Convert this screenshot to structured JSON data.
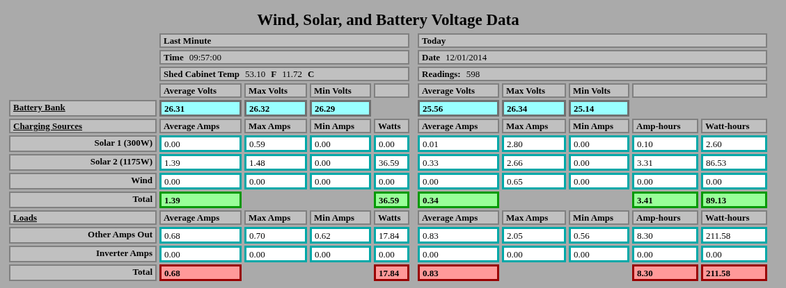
{
  "title": "Wind, Solar, and Battery Voltage Data",
  "info_rows": [
    {
      "left": [
        {
          "text": "Last Minute",
          "bold": true
        }
      ],
      "right": [
        {
          "text": "Today",
          "bold": true
        }
      ]
    },
    {
      "left": [
        {
          "text": "Time",
          "bold": true
        },
        {
          "text": "09:57:00",
          "bold": false
        }
      ],
      "right": [
        {
          "text": "Date",
          "bold": true
        },
        {
          "text": "12/01/2014",
          "bold": false
        }
      ]
    },
    {
      "left": [
        {
          "text": "Shed Cabinet Temp",
          "bold": true
        },
        {
          "text": "53.10",
          "bold": false
        },
        {
          "text": "F",
          "bold": true
        },
        {
          "text": "11.72",
          "bold": false
        },
        {
          "text": "C",
          "bold": true
        }
      ],
      "right": [
        {
          "text": "Readings:",
          "bold": true
        },
        {
          "text": "598",
          "bold": false
        }
      ]
    }
  ],
  "rows": [
    {
      "cells": [
        {
          "kind": "header",
          "text": "Average Volts"
        },
        {
          "kind": "header",
          "text": "Max Volts"
        },
        {
          "kind": "header",
          "text": "Min Volts"
        },
        {
          "kind": "empty"
        },
        {
          "kind": "header",
          "text": "Average Volts"
        },
        {
          "kind": "header",
          "text": "Max Volts"
        },
        {
          "kind": "header",
          "text": "Min Volts"
        },
        {
          "kind": "empty-wide"
        }
      ]
    },
    {
      "label": {
        "kind": "section",
        "text": "Battery Bank"
      },
      "cells": [
        {
          "kind": "volts",
          "text": "26.31"
        },
        {
          "kind": "volts",
          "text": "26.32"
        },
        {
          "kind": "volts",
          "text": "26.29"
        },
        {
          "kind": "blank"
        },
        {
          "kind": "volts",
          "text": "25.56"
        },
        {
          "kind": "volts",
          "text": "26.34"
        },
        {
          "kind": "volts",
          "text": "25.14"
        },
        {
          "kind": "blank"
        },
        {
          "kind": "blank"
        }
      ]
    },
    {
      "label": {
        "kind": "section",
        "text": "Charging Sources"
      },
      "cells": [
        {
          "kind": "header",
          "text": "Average Amps"
        },
        {
          "kind": "header",
          "text": "Max Amps"
        },
        {
          "kind": "header",
          "text": "Min Amps"
        },
        {
          "kind": "header",
          "text": "Watts"
        },
        {
          "kind": "header",
          "text": "Average Amps"
        },
        {
          "kind": "header",
          "text": "Max Amps"
        },
        {
          "kind": "header",
          "text": "Min Amps"
        },
        {
          "kind": "header",
          "text": "Amp-hours"
        },
        {
          "kind": "header",
          "text": "Watt-hours"
        }
      ]
    },
    {
      "label": {
        "kind": "label",
        "text": "Solar 1 (300W)"
      },
      "cells": [
        {
          "kind": "value",
          "text": "0.00"
        },
        {
          "kind": "value",
          "text": "0.59"
        },
        {
          "kind": "value",
          "text": "0.00"
        },
        {
          "kind": "value",
          "text": "0.00"
        },
        {
          "kind": "value",
          "text": "0.01"
        },
        {
          "kind": "value",
          "text": "2.80"
        },
        {
          "kind": "value",
          "text": "0.00"
        },
        {
          "kind": "value",
          "text": "0.10"
        },
        {
          "kind": "value",
          "text": "2.60"
        }
      ]
    },
    {
      "label": {
        "kind": "label",
        "text": "Solar 2 (1175W)"
      },
      "cells": [
        {
          "kind": "value",
          "text": "1.39"
        },
        {
          "kind": "value",
          "text": "1.48"
        },
        {
          "kind": "value",
          "text": "0.00"
        },
        {
          "kind": "value",
          "text": "36.59"
        },
        {
          "kind": "value",
          "text": "0.33"
        },
        {
          "kind": "value",
          "text": "2.66"
        },
        {
          "kind": "value",
          "text": "0.00"
        },
        {
          "kind": "value",
          "text": "3.31"
        },
        {
          "kind": "value",
          "text": "86.53"
        }
      ]
    },
    {
      "label": {
        "kind": "label",
        "text": "Wind"
      },
      "cells": [
        {
          "kind": "value",
          "text": "0.00"
        },
        {
          "kind": "value",
          "text": "0.00"
        },
        {
          "kind": "value",
          "text": "0.00"
        },
        {
          "kind": "value",
          "text": "0.00"
        },
        {
          "kind": "value",
          "text": "0.00"
        },
        {
          "kind": "value",
          "text": "0.65"
        },
        {
          "kind": "value",
          "text": "0.00"
        },
        {
          "kind": "value",
          "text": "0.00"
        },
        {
          "kind": "value",
          "text": "0.00"
        }
      ]
    },
    {
      "label": {
        "kind": "label",
        "text": "Total"
      },
      "cells": [
        {
          "kind": "charge-total",
          "text": "1.39"
        },
        {
          "kind": "blank"
        },
        {
          "kind": "blank"
        },
        {
          "kind": "charge-total",
          "text": "36.59"
        },
        {
          "kind": "charge-total",
          "text": "0.34"
        },
        {
          "kind": "blank"
        },
        {
          "kind": "blank"
        },
        {
          "kind": "charge-total",
          "text": "3.41"
        },
        {
          "kind": "charge-total",
          "text": "89.13"
        }
      ]
    },
    {
      "label": {
        "kind": "section",
        "text": "Loads"
      },
      "cells": [
        {
          "kind": "header",
          "text": "Average Amps"
        },
        {
          "kind": "header",
          "text": "Max Amps"
        },
        {
          "kind": "header",
          "text": "Min Amps"
        },
        {
          "kind": "header",
          "text": "Watts"
        },
        {
          "kind": "header",
          "text": "Average Amps"
        },
        {
          "kind": "header",
          "text": "Max Amps"
        },
        {
          "kind": "header",
          "text": "Min Amps"
        },
        {
          "kind": "header",
          "text": "Amp-hours"
        },
        {
          "kind": "header",
          "text": "Watt-hours"
        }
      ]
    },
    {
      "label": {
        "kind": "label",
        "text": "Other Amps Out"
      },
      "cells": [
        {
          "kind": "value",
          "text": "0.68"
        },
        {
          "kind": "value",
          "text": "0.70"
        },
        {
          "kind": "value",
          "text": "0.62"
        },
        {
          "kind": "value",
          "text": "17.84"
        },
        {
          "kind": "value",
          "text": "0.83"
        },
        {
          "kind": "value",
          "text": "2.05"
        },
        {
          "kind": "value",
          "text": "0.56"
        },
        {
          "kind": "value",
          "text": "8.30"
        },
        {
          "kind": "value",
          "text": "211.58"
        }
      ]
    },
    {
      "label": {
        "kind": "label",
        "text": "Inverter Amps"
      },
      "cells": [
        {
          "kind": "value",
          "text": "0.00"
        },
        {
          "kind": "value",
          "text": "0.00"
        },
        {
          "kind": "value",
          "text": "0.00"
        },
        {
          "kind": "value",
          "text": "0.00"
        },
        {
          "kind": "value",
          "text": "0.00"
        },
        {
          "kind": "value",
          "text": "0.00"
        },
        {
          "kind": "value",
          "text": "0.00"
        },
        {
          "kind": "value",
          "text": "0.00"
        },
        {
          "kind": "value",
          "text": "0.00"
        }
      ]
    },
    {
      "label": {
        "kind": "label",
        "text": "Total"
      },
      "cells": [
        {
          "kind": "load-total",
          "text": "0.68"
        },
        {
          "kind": "blank"
        },
        {
          "kind": "blank"
        },
        {
          "kind": "load-total",
          "text": "17.84"
        },
        {
          "kind": "load-total",
          "text": "0.83"
        },
        {
          "kind": "blank"
        },
        {
          "kind": "blank"
        },
        {
          "kind": "load-total",
          "text": "8.30"
        },
        {
          "kind": "load-total",
          "text": "211.58"
        }
      ]
    }
  ]
}
